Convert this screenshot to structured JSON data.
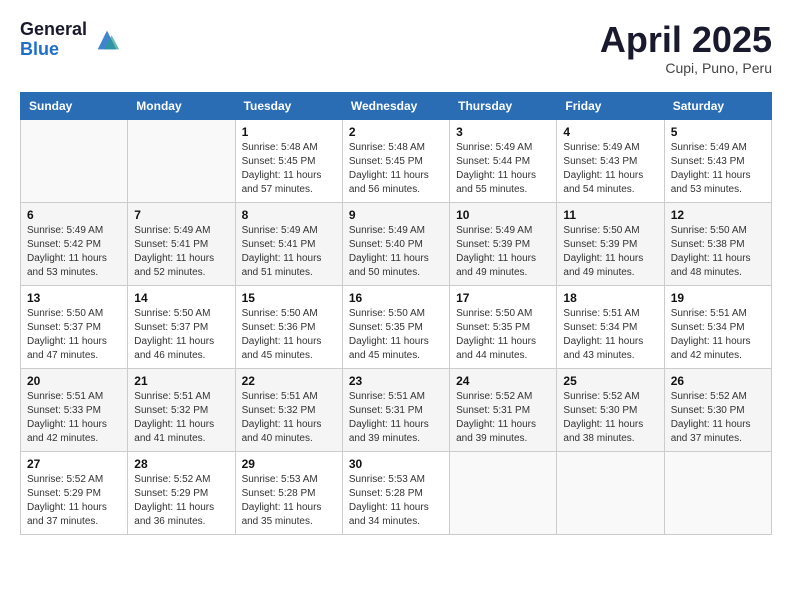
{
  "header": {
    "logo_general": "General",
    "logo_blue": "Blue",
    "month_title": "April 2025",
    "subtitle": "Cupi, Puno, Peru"
  },
  "calendar": {
    "days_of_week": [
      "Sunday",
      "Monday",
      "Tuesday",
      "Wednesday",
      "Thursday",
      "Friday",
      "Saturday"
    ],
    "weeks": [
      [
        {
          "day": "",
          "info": ""
        },
        {
          "day": "",
          "info": ""
        },
        {
          "day": "1",
          "info": "Sunrise: 5:48 AM\nSunset: 5:45 PM\nDaylight: 11 hours and 57 minutes."
        },
        {
          "day": "2",
          "info": "Sunrise: 5:48 AM\nSunset: 5:45 PM\nDaylight: 11 hours and 56 minutes."
        },
        {
          "day": "3",
          "info": "Sunrise: 5:49 AM\nSunset: 5:44 PM\nDaylight: 11 hours and 55 minutes."
        },
        {
          "day": "4",
          "info": "Sunrise: 5:49 AM\nSunset: 5:43 PM\nDaylight: 11 hours and 54 minutes."
        },
        {
          "day": "5",
          "info": "Sunrise: 5:49 AM\nSunset: 5:43 PM\nDaylight: 11 hours and 53 minutes."
        }
      ],
      [
        {
          "day": "6",
          "info": "Sunrise: 5:49 AM\nSunset: 5:42 PM\nDaylight: 11 hours and 53 minutes."
        },
        {
          "day": "7",
          "info": "Sunrise: 5:49 AM\nSunset: 5:41 PM\nDaylight: 11 hours and 52 minutes."
        },
        {
          "day": "8",
          "info": "Sunrise: 5:49 AM\nSunset: 5:41 PM\nDaylight: 11 hours and 51 minutes."
        },
        {
          "day": "9",
          "info": "Sunrise: 5:49 AM\nSunset: 5:40 PM\nDaylight: 11 hours and 50 minutes."
        },
        {
          "day": "10",
          "info": "Sunrise: 5:49 AM\nSunset: 5:39 PM\nDaylight: 11 hours and 49 minutes."
        },
        {
          "day": "11",
          "info": "Sunrise: 5:50 AM\nSunset: 5:39 PM\nDaylight: 11 hours and 49 minutes."
        },
        {
          "day": "12",
          "info": "Sunrise: 5:50 AM\nSunset: 5:38 PM\nDaylight: 11 hours and 48 minutes."
        }
      ],
      [
        {
          "day": "13",
          "info": "Sunrise: 5:50 AM\nSunset: 5:37 PM\nDaylight: 11 hours and 47 minutes."
        },
        {
          "day": "14",
          "info": "Sunrise: 5:50 AM\nSunset: 5:37 PM\nDaylight: 11 hours and 46 minutes."
        },
        {
          "day": "15",
          "info": "Sunrise: 5:50 AM\nSunset: 5:36 PM\nDaylight: 11 hours and 45 minutes."
        },
        {
          "day": "16",
          "info": "Sunrise: 5:50 AM\nSunset: 5:35 PM\nDaylight: 11 hours and 45 minutes."
        },
        {
          "day": "17",
          "info": "Sunrise: 5:50 AM\nSunset: 5:35 PM\nDaylight: 11 hours and 44 minutes."
        },
        {
          "day": "18",
          "info": "Sunrise: 5:51 AM\nSunset: 5:34 PM\nDaylight: 11 hours and 43 minutes."
        },
        {
          "day": "19",
          "info": "Sunrise: 5:51 AM\nSunset: 5:34 PM\nDaylight: 11 hours and 42 minutes."
        }
      ],
      [
        {
          "day": "20",
          "info": "Sunrise: 5:51 AM\nSunset: 5:33 PM\nDaylight: 11 hours and 42 minutes."
        },
        {
          "day": "21",
          "info": "Sunrise: 5:51 AM\nSunset: 5:32 PM\nDaylight: 11 hours and 41 minutes."
        },
        {
          "day": "22",
          "info": "Sunrise: 5:51 AM\nSunset: 5:32 PM\nDaylight: 11 hours and 40 minutes."
        },
        {
          "day": "23",
          "info": "Sunrise: 5:51 AM\nSunset: 5:31 PM\nDaylight: 11 hours and 39 minutes."
        },
        {
          "day": "24",
          "info": "Sunrise: 5:52 AM\nSunset: 5:31 PM\nDaylight: 11 hours and 39 minutes."
        },
        {
          "day": "25",
          "info": "Sunrise: 5:52 AM\nSunset: 5:30 PM\nDaylight: 11 hours and 38 minutes."
        },
        {
          "day": "26",
          "info": "Sunrise: 5:52 AM\nSunset: 5:30 PM\nDaylight: 11 hours and 37 minutes."
        }
      ],
      [
        {
          "day": "27",
          "info": "Sunrise: 5:52 AM\nSunset: 5:29 PM\nDaylight: 11 hours and 37 minutes."
        },
        {
          "day": "28",
          "info": "Sunrise: 5:52 AM\nSunset: 5:29 PM\nDaylight: 11 hours and 36 minutes."
        },
        {
          "day": "29",
          "info": "Sunrise: 5:53 AM\nSunset: 5:28 PM\nDaylight: 11 hours and 35 minutes."
        },
        {
          "day": "30",
          "info": "Sunrise: 5:53 AM\nSunset: 5:28 PM\nDaylight: 11 hours and 34 minutes."
        },
        {
          "day": "",
          "info": ""
        },
        {
          "day": "",
          "info": ""
        },
        {
          "day": "",
          "info": ""
        }
      ]
    ]
  }
}
